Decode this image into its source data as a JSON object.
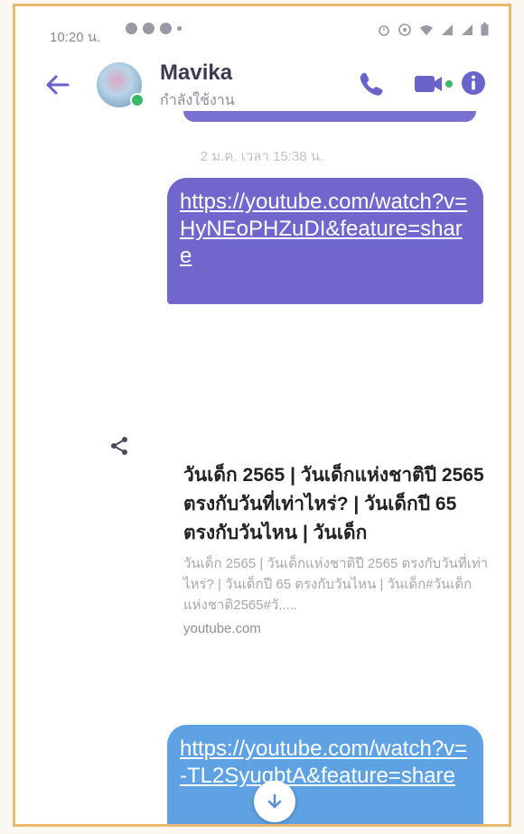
{
  "status_bar": {
    "time": "10:20 น."
  },
  "header": {
    "contact_name": "Mavika",
    "contact_status": "กำลังใช้งาน"
  },
  "chat": {
    "timestamp": "2 ม.ค. เวลา 15:38 น.",
    "message1": "https://youtube.com/watch?v=HyNEoPHZuDI&feature=share",
    "link_preview": {
      "title": "วันเด็ก 2565 | วันเด็กแห่งชาติปี 2565 ตรงกับวันที่เท่าไหร่? | วันเด็กปี 65 ตรงกับวันไหน | วันเด็ก",
      "description": "วันเด็ก 2565 | วันเด็กแห่งชาติปี 2565 ตรงกับวันที่เท่าไหร่? | วันเด็กปี 65 ตรงกับวันไหน | วันเด็ก#วันเด็กแห่งชาติ2565#วั.....",
      "domain": "youtube.com"
    },
    "message2": "https://youtube.com/watch?v=-TL2SyugbtA&feature=share"
  },
  "colors": {
    "accent": "#6a63c9",
    "bubble_purple": "#7066cb",
    "bubble_blue": "#5ea2e4",
    "online": "#3bb86a"
  },
  "icons": [
    "back-arrow-icon",
    "phone-icon",
    "video-icon",
    "info-icon",
    "share-icon",
    "arrow-down-icon"
  ]
}
